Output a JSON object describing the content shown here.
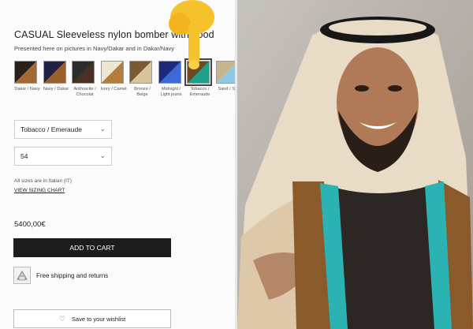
{
  "product": {
    "title": "CASUAL Sleeveless nylon bomber with hood",
    "subtitle": "Presented here on pictures in Navy/Dakar and in Dakar/Navy",
    "price": "5400,00€"
  },
  "swatches": [
    {
      "label": "Dakar / Navy",
      "c1": "#2a2219",
      "c2": "#a46a34"
    },
    {
      "label": "Navy / Dakar",
      "c1": "#1f2245",
      "c2": "#9a6030"
    },
    {
      "label": "Anthracite / Chocolat",
      "c1": "#2c2c2c",
      "c2": "#4a3023"
    },
    {
      "label": "Ivory / Camel",
      "c1": "#efe6d2",
      "c2": "#b57b3c"
    },
    {
      "label": "Bronze / Beige",
      "c1": "#7a5a33",
      "c2": "#d9c59d"
    },
    {
      "label": "Midnight / Light jeans",
      "c1": "#1d2a7a",
      "c2": "#3d6ad9"
    },
    {
      "label": "Tobacco / Emeraude",
      "c1": "#6b4a24",
      "c2": "#1fa08a"
    },
    {
      "label": "Sand / Sky",
      "c1": "#c6b58f",
      "c2": "#8ccbe8"
    }
  ],
  "selected_swatch": "Tobacco / Emeraude",
  "selects": {
    "color_value": "Tobacco / Emeraude",
    "size_value": "54"
  },
  "size_note": "All sizes are in Italian (IT)",
  "size_chart_link": "VIEW SIZING CHART",
  "buttons": {
    "add_to_cart": "ADD TO CART",
    "wishlist": "Save to your wishlist"
  },
  "shipping_text": "Free shipping and returns",
  "icons": {
    "chevron": "chevron-down-icon",
    "heart": "heart-icon",
    "shipping": "shipping-box-icon"
  }
}
